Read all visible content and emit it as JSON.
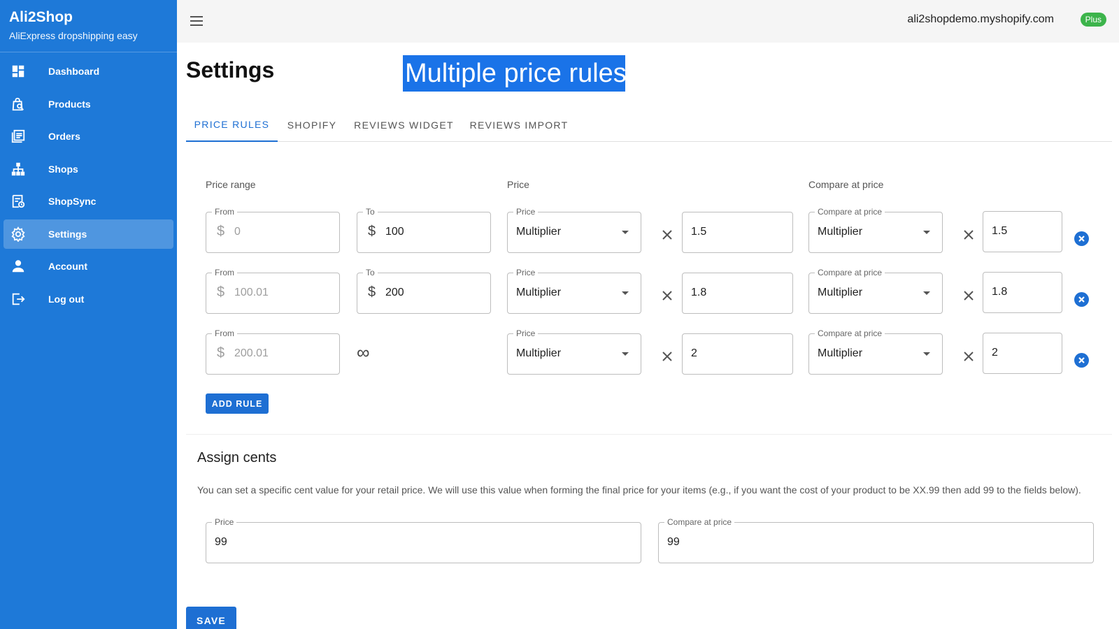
{
  "sidebar": {
    "title": "Ali2Shop",
    "subtitle": "AliExpress dropshipping easy",
    "items": [
      {
        "label": "Dashboard",
        "icon": "dashboard-icon"
      },
      {
        "label": "Products",
        "icon": "products-search-icon"
      },
      {
        "label": "Orders",
        "icon": "orders-icon"
      },
      {
        "label": "Shops",
        "icon": "sitemap-icon"
      },
      {
        "label": "ShopSync",
        "icon": "shopsync-icon"
      },
      {
        "label": "Settings",
        "icon": "gear-icon",
        "active": true
      },
      {
        "label": "Account",
        "icon": "person-icon"
      },
      {
        "label": "Log out",
        "icon": "logout-icon"
      }
    ]
  },
  "topbar": {
    "shop_domain": "ali2shopdemo.myshopify.com",
    "plan_badge": "Plus"
  },
  "header": {
    "title": "Settings",
    "highlight": "Multiple price rules"
  },
  "tabs": [
    {
      "label": "PRICE RULES",
      "active": true
    },
    {
      "label": "SHOPIFY"
    },
    {
      "label": "REVIEWS WIDGET"
    },
    {
      "label": "REVIEWS IMPORT"
    }
  ],
  "columns": {
    "price_range": "Price range",
    "price": "Price",
    "compare_at_price": "Compare at price"
  },
  "labels": {
    "from": "From",
    "to": "To",
    "price": "Price",
    "compare_at_price": "Compare at price",
    "currency": "$",
    "infinity": "∞"
  },
  "rules": [
    {
      "from": "0",
      "to": "100",
      "price_type": "Multiplier",
      "price_value": "1.5",
      "compare_type": "Multiplier",
      "compare_value": "1.5"
    },
    {
      "from": "100.01",
      "to": "200",
      "price_type": "Multiplier",
      "price_value": "1.8",
      "compare_type": "Multiplier",
      "compare_value": "1.8"
    },
    {
      "from": "200.01",
      "to": null,
      "price_type": "Multiplier",
      "price_value": "2",
      "compare_type": "Multiplier",
      "compare_value": "2"
    }
  ],
  "add_rule_label": "ADD RULE",
  "cents": {
    "title": "Assign cents",
    "description": "You can set a specific cent value for your retail price. We will use this value when forming the final price for your items (e.g., if you want the cost of your product to be XX.99 then add 99 to the fields below).",
    "price_label": "Price",
    "price_value": "99",
    "compare_label": "Compare at price",
    "compare_value": "99"
  },
  "save_label": "SAVE",
  "colors": {
    "sidebar": "#1e79d8",
    "accent": "#1e6fd3",
    "highlight": "#1a73e8",
    "badge": "#3cb44b"
  }
}
